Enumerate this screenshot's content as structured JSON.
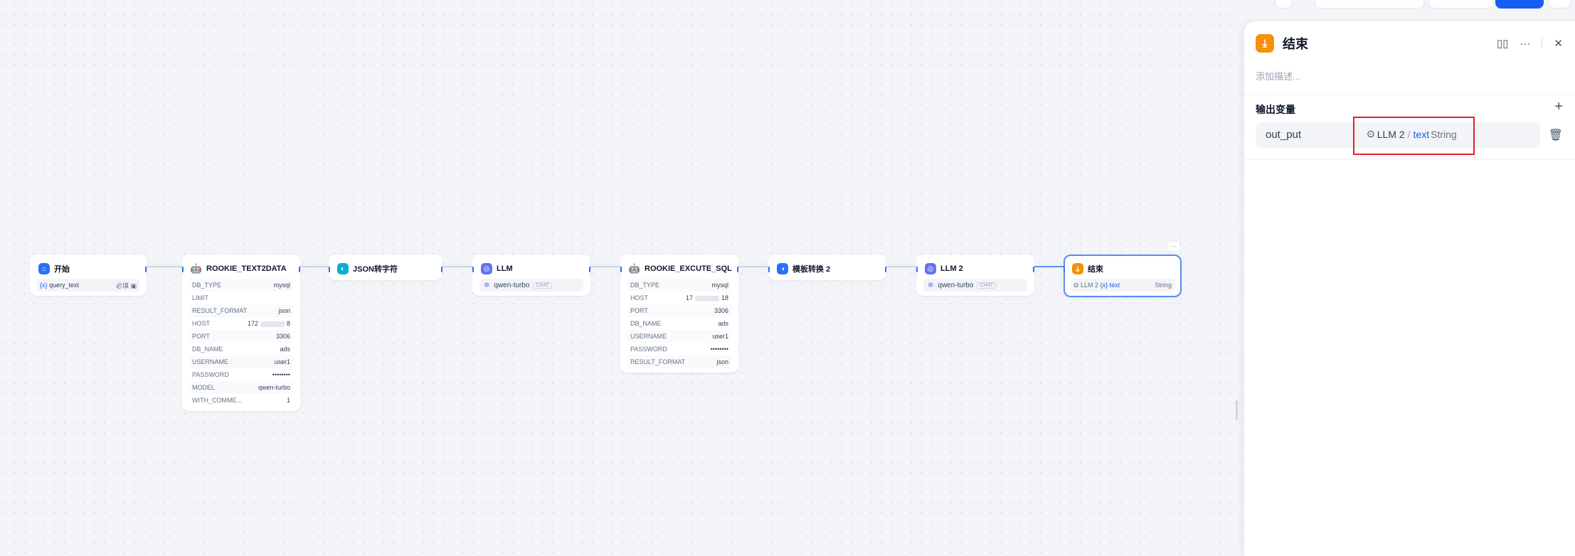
{
  "nodes": {
    "start": {
      "title": "开始",
      "var": "query_text",
      "badge": "必填 ▣"
    },
    "text2data": {
      "title": "ROOKIE_TEXT2DATA",
      "rows": [
        {
          "k": "DB_TYPE",
          "v": "mysql"
        },
        {
          "k": "LIMIT",
          "v": ""
        },
        {
          "k": "RESULT_FORMAT",
          "v": "json"
        },
        {
          "k": "HOST",
          "v": "172",
          "v2": "8"
        },
        {
          "k": "PORT",
          "v": "3306"
        },
        {
          "k": "DB_NAME",
          "v": "ads"
        },
        {
          "k": "USERNAME",
          "v": "user1"
        },
        {
          "k": "PASSWORD",
          "v": "••••••••"
        },
        {
          "k": "MODEL",
          "v": "qwen-turbo"
        },
        {
          "k": "WITH_COMME...",
          "v": "1"
        }
      ]
    },
    "json": {
      "title": "JSON转字符"
    },
    "llm": {
      "title": "LLM",
      "model": "qwen-turbo",
      "mode": "CHAT"
    },
    "execute": {
      "title": "ROOKIE_EXCUTE_SQL",
      "rows": [
        {
          "k": "DB_TYPE",
          "v": "mysql"
        },
        {
          "k": "HOST",
          "v": "17",
          "v2": "18"
        },
        {
          "k": "PORT",
          "v": "3306"
        },
        {
          "k": "DB_NAME",
          "v": "ads"
        },
        {
          "k": "USERNAME",
          "v": "user1"
        },
        {
          "k": "PASSWORD",
          "v": "••••••••"
        },
        {
          "k": "RESULT_FORMAT",
          "v": "json"
        }
      ]
    },
    "template": {
      "title": "模板转换 2"
    },
    "llm2": {
      "title": "LLM 2",
      "model": "qwen-turbo",
      "mode": "CHAT"
    },
    "end": {
      "title": "结束",
      "src": "LLM 2",
      "var": "text",
      "type": "String",
      "more": "···"
    }
  },
  "panel": {
    "title": "结束",
    "desc_placeholder": "添加描述...",
    "section": "输出变量",
    "add": "+",
    "variable": {
      "name": "out_put",
      "src_node": "LLM 2",
      "slash": "/",
      "var": "text",
      "type": "String"
    }
  },
  "colors": {
    "accent": "#155eef",
    "end_icon": "#f79009",
    "highlight": "#e0212b"
  }
}
